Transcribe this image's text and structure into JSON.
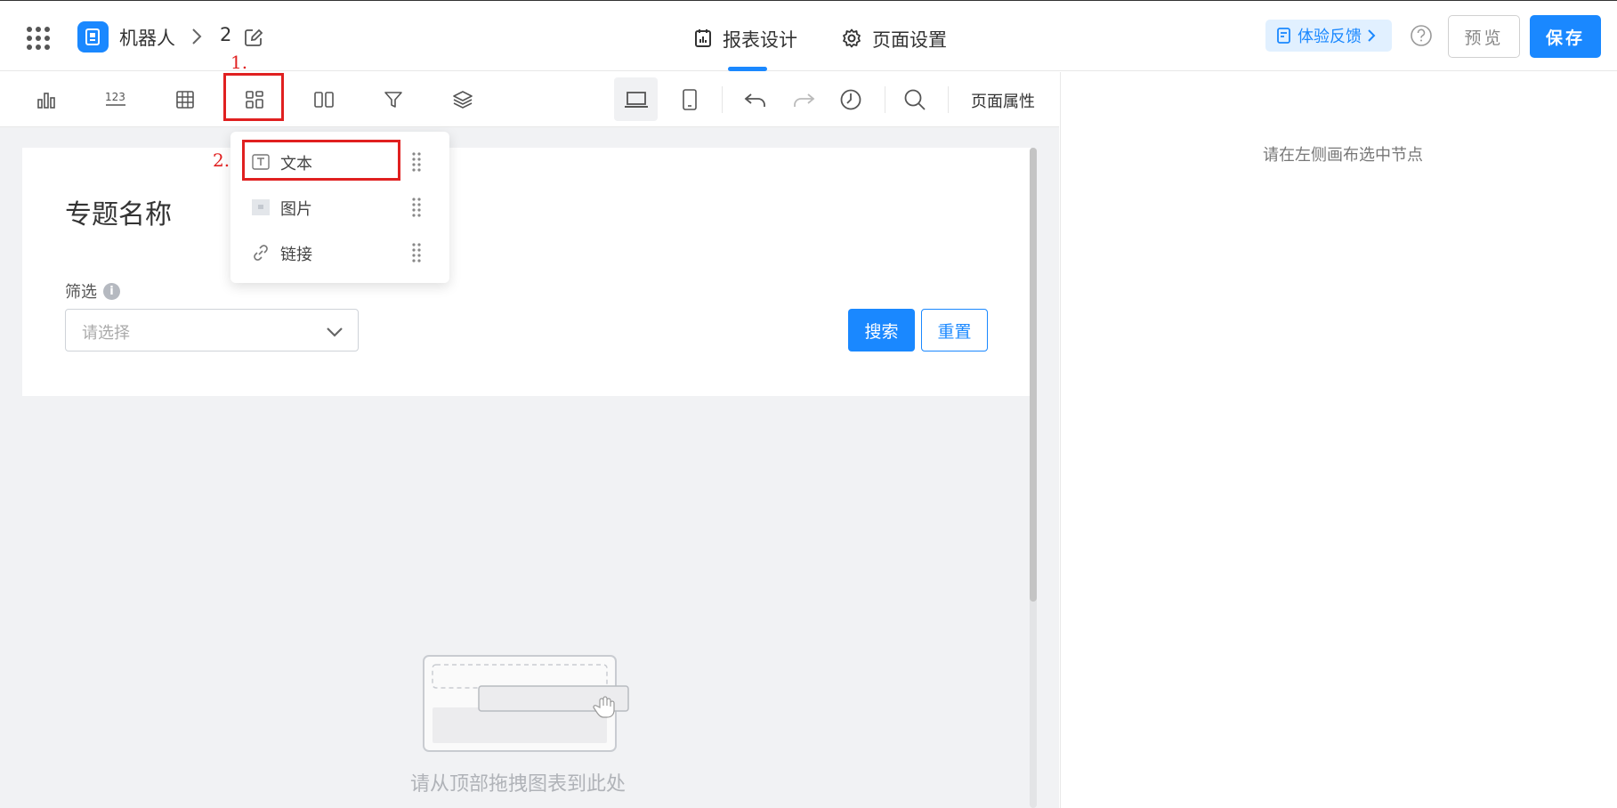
{
  "header": {
    "app_name": "机器人",
    "page_number": "2",
    "tabs": [
      {
        "label": "报表设计",
        "active": true,
        "icon": "report-design-icon"
      },
      {
        "label": "页面设置",
        "active": false,
        "icon": "gear-icon"
      }
    ],
    "feedback_label": "体验反馈",
    "preview_label": "预览",
    "save_label": "保存"
  },
  "toolbar": {
    "tools": [
      "bar-chart-icon",
      "number-card-icon",
      "table-icon",
      "components-icon",
      "layout-columns-icon",
      "filter-icon",
      "layers-icon"
    ],
    "device": [
      "desktop-icon",
      "mobile-icon"
    ],
    "history": [
      "undo-icon",
      "redo-icon",
      "history-icon"
    ],
    "search": "search-icon",
    "page_props_label": "页面属性"
  },
  "dropdown": {
    "items": [
      {
        "label": "文本",
        "icon": "text-icon"
      },
      {
        "label": "图片",
        "icon": "image-icon"
      },
      {
        "label": "链接",
        "icon": "link-icon"
      }
    ]
  },
  "canvas": {
    "report_title": "专题名称",
    "filter_label": "筛选",
    "filter_info": "i",
    "select_placeholder": "请选择",
    "search_label": "搜索",
    "reset_label": "重置",
    "empty_hint": "请从顶部拖拽图表到此处"
  },
  "right_panel": {
    "hint": "请在左侧画布选中节点"
  },
  "annotations": [
    "1.",
    "2."
  ],
  "colors": {
    "accent": "#1a88ff",
    "annotation": "#e02020",
    "feedback_bg": "#e1f0ff",
    "canvas_bg": "#f1f2f4"
  }
}
